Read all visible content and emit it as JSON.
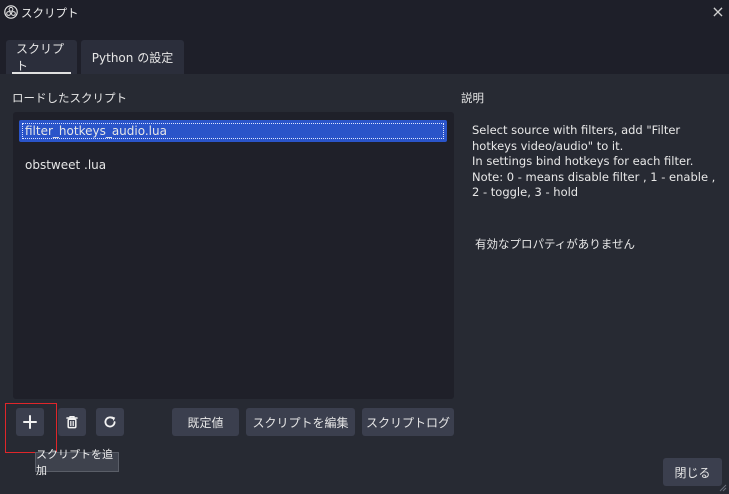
{
  "window": {
    "title": "スクリプト",
    "close_glyph": "×"
  },
  "tabs": [
    {
      "label": "スクリプト",
      "active": true
    },
    {
      "label": "Python の設定",
      "active": false
    }
  ],
  "loaded_scripts": {
    "label": "ロードしたスクリプト",
    "items": [
      {
        "name": "filter_hotkeys_audio.lua",
        "selected": true
      },
      {
        "name": "obstweet .lua",
        "selected": false
      }
    ]
  },
  "description": {
    "label": "説明",
    "lines": [
      "Select source with filters, add \"Filter",
      "hotkeys video/audio\" to it.",
      "In settings bind hotkeys for each filter.",
      "Note: 0 - means disable filter , 1 - enable ,",
      "2 - toggle, 3 - hold"
    ],
    "no_properties": "有効なプロパティがありません"
  },
  "toolbar": {
    "add_icon": "plus-icon",
    "remove_icon": "trash-icon",
    "reload_icon": "refresh-icon",
    "defaults_label": "既定値",
    "edit_label": "スクリプトを編集",
    "log_label": "スクリプトログ",
    "add_tooltip": "スクリプトを追加"
  },
  "footer": {
    "close_label": "閉じる"
  },
  "colors": {
    "background": "#1e1f29",
    "panel": "#272a33",
    "list_bg": "#1f2029",
    "selection": "#2a54c9",
    "button": "#3b3f4e",
    "highlight": "#e0262a"
  }
}
